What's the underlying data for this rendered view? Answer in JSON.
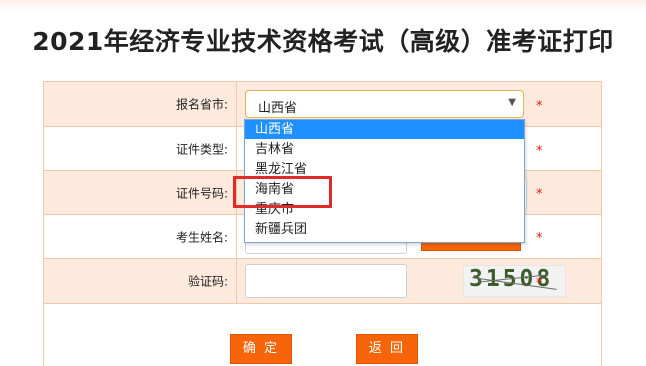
{
  "page": {
    "title": "2021年经济专业技术资格考试（高级）准考证打印"
  },
  "form": {
    "rows": [
      {
        "label": "报名省市:"
      },
      {
        "label": "证件类型:"
      },
      {
        "label": "证件号码:"
      },
      {
        "label": "考生姓名:"
      },
      {
        "label": "验证码:"
      }
    ],
    "required_mark": "*",
    "province_select": {
      "selected": "山西省"
    },
    "captcha": {
      "text": "31508"
    },
    "buttons": {
      "confirm": "确 定",
      "back": "返 回"
    }
  },
  "dropdown": {
    "options": [
      "山西省",
      "吉林省",
      "黑龙江省",
      "海南省",
      "重庆市",
      "新疆兵团"
    ],
    "selected_index": 0,
    "highlighted_option": "海南省"
  },
  "colors": {
    "accent": "#f7650b",
    "row_shade": "#fdeadc",
    "border": "#f2c9ae",
    "selection": "#1e90ff",
    "required": "#e01b1b",
    "highlight": "#e32a2a"
  }
}
